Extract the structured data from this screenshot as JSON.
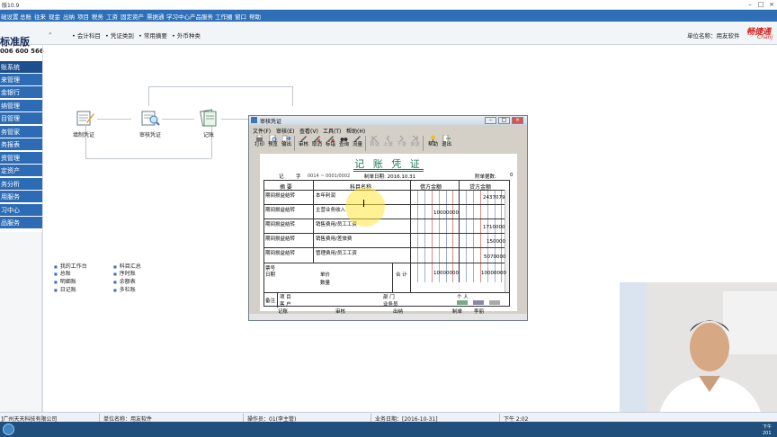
{
  "window": {
    "title": "版10.9"
  },
  "menubar": [
    "础设置",
    "总账",
    "往来",
    "现金",
    "出纳",
    "项目",
    "税务",
    "工资",
    "固定资产",
    "票据通",
    "学习中心",
    "产品服务",
    "工作圈",
    "窗口",
    "帮助"
  ],
  "brand": {
    "name": "标准版",
    "phone": "006 600 566"
  },
  "toolbar": [
    "会计科目",
    "凭证类别",
    "常用摘要",
    "外币种类"
  ],
  "unit_label": "单位名称：用友软件",
  "logo": {
    "main": "畅捷通",
    "sub": "Chanj"
  },
  "sidebar": [
    "账系统",
    "来管理",
    "金银行",
    "纳管理",
    "目管理",
    "务管家",
    "务报表",
    "资管理",
    "定资产",
    "务分析",
    "用服务",
    "习中心",
    "品服务"
  ],
  "flow": [
    {
      "label": "填制凭证"
    },
    {
      "label": "审核凭证"
    },
    {
      "label": "记账"
    }
  ],
  "links_col1": [
    "我的工作台",
    "总账",
    "明细账",
    "日记账"
  ],
  "links_col2": [
    "科目汇总",
    "序时账",
    "余额表",
    "多栏账"
  ],
  "status": {
    "company": "]广州天天科技有限公司",
    "unit": "单位名称：用友软件",
    "operator": "操作员：01(李主管)",
    "date": "业务日期：[2016-10-31]",
    "time": "下午 2:02"
  },
  "tray": {
    "time": "下午",
    "year": "201"
  },
  "dialog": {
    "title": "审核凭证",
    "menu": [
      "文件(F)",
      "审核(E)",
      "查看(V)",
      "工具(T)",
      "帮助(H)"
    ],
    "tools": [
      {
        "label": "打印",
        "enabled": true
      },
      {
        "label": "预览",
        "enabled": true
      },
      {
        "label": "输出",
        "enabled": true
      },
      {
        "label": "审核",
        "enabled": true
      },
      {
        "label": "取消",
        "enabled": true
      },
      {
        "label": "标错",
        "enabled": true
      },
      {
        "label": "查询",
        "enabled": true
      },
      {
        "label": "流量",
        "enabled": true
      },
      {
        "label": "首张",
        "enabled": false
      },
      {
        "label": "上张",
        "enabled": false
      },
      {
        "label": "下张",
        "enabled": false
      },
      {
        "label": "末张",
        "enabled": false
      },
      {
        "label": "帮助",
        "enabled": true
      },
      {
        "label": "退出",
        "enabled": true
      }
    ],
    "voucher": {
      "title": "记 账 凭 证",
      "type_label": "记",
      "zi": "字",
      "number": "0014 ~ 0001/0002",
      "date": "制单日期: 2016.10.31",
      "attachments": "附单据数:",
      "attachments_value": "0",
      "headers": {
        "summary": "摘 要",
        "account": "科目名称",
        "debit": "借方金额",
        "credit": "贷方金额"
      },
      "rows": [
        {
          "summary": "期间损益结转",
          "account": "本年利润",
          "debit": "",
          "credit": "2437079"
        },
        {
          "summary": "期间损益结转",
          "account": "主营业务收入",
          "debit": "10000000",
          "credit": ""
        },
        {
          "summary": "期间损益结转",
          "account": "销售费用/员工工资",
          "debit": "",
          "credit": "1710000"
        },
        {
          "summary": "期间损益结转",
          "account": "销售费用/差旅费",
          "debit": "",
          "credit": "150000"
        },
        {
          "summary": "期间损益结转",
          "account": "管理费用/员工工资",
          "debit": "",
          "credit": "5070000"
        }
      ],
      "footer": {
        "piao": "票号",
        "riqi": "日期",
        "danjia": "单价",
        "shuliang": "数量",
        "heji": "合 计",
        "debit_total": "10000000",
        "credit_total": "10000000",
        "beizhu": "备注",
        "xiangmu": "项 目",
        "bumen": "部 门",
        "geren": "个 人",
        "kehu": "客 户",
        "yewuyuan": "业务员"
      },
      "signs": {
        "jizhang": "记账",
        "shenhe": "审核",
        "chuna": "出纳",
        "zhidan": "制单",
        "maker": "李丽"
      }
    }
  }
}
